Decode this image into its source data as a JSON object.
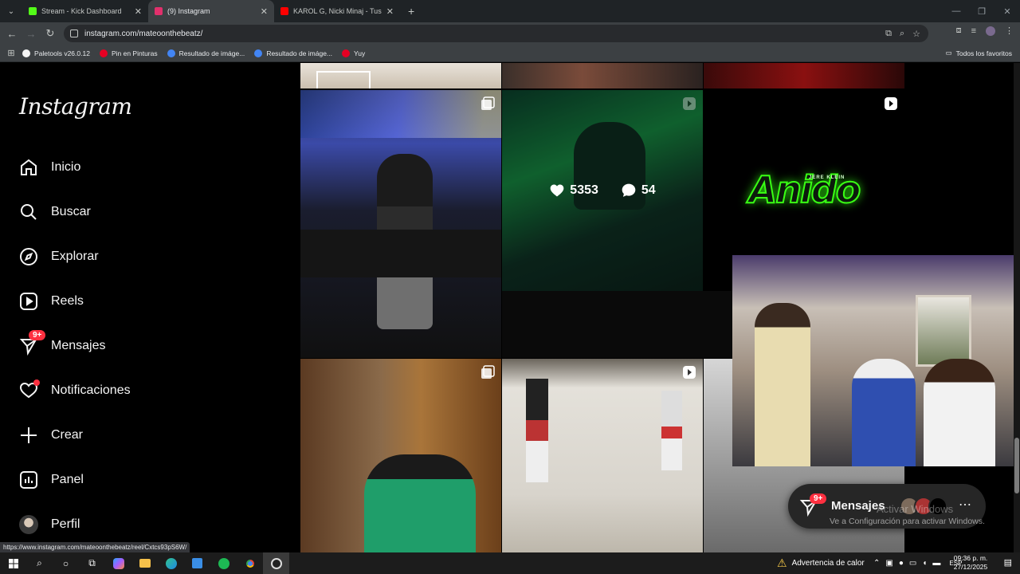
{
  "browser": {
    "tabs": [
      {
        "title": "Stream - Kick Dashboard",
        "favicon_color": "#53fc18",
        "active": false
      },
      {
        "title": "(9) Instagram",
        "favicon_color": "#e1306c",
        "active": true
      },
      {
        "title": "KAROL G, Nicki Minaj - Tusa (O",
        "favicon_color": "#ff0000",
        "active": false
      }
    ],
    "url": "instagram.com/mateoonthebeatz/",
    "bookmarks": [
      {
        "label": "Paletools v26.0.12",
        "color": "#f5f5f5"
      },
      {
        "label": "Pin en Pinturas",
        "color": "#e60023"
      },
      {
        "label": "Resultado de imáge...",
        "color": "#4285f4"
      },
      {
        "label": "Resultado de imáge...",
        "color": "#4285f4"
      },
      {
        "label": "Yuy",
        "color": "#e60023"
      }
    ],
    "all_bookmarks": "Todos los favoritos"
  },
  "instagram": {
    "logo": "Instagram",
    "nav": [
      {
        "label": "Inicio",
        "icon": "home-icon"
      },
      {
        "label": "Buscar",
        "icon": "search-icon"
      },
      {
        "label": "Explorar",
        "icon": "compass-icon"
      },
      {
        "label": "Reels",
        "icon": "reels-icon"
      },
      {
        "label": "Mensajes",
        "icon": "messenger-icon",
        "badge": "9+"
      },
      {
        "label": "Notificaciones",
        "icon": "heart-icon",
        "dot": true
      },
      {
        "label": "Crear",
        "icon": "plus-icon"
      },
      {
        "label": "Panel",
        "icon": "dashboard-icon"
      },
      {
        "label": "Perfil",
        "icon": "avatar"
      }
    ],
    "hover_post": {
      "likes": "5353",
      "comments": "54"
    },
    "neon_post": {
      "title": "Anido",
      "subtitle": "JERE KLEIN"
    },
    "messages_pill": {
      "label": "Mensajes",
      "badge": "9+"
    }
  },
  "status_url": "https://www.instagram.com/mateoonthebeatz/reel/Cxtcs93pS6W/",
  "windows": {
    "activate_title": "Activar Windows",
    "activate_text": "Ve a Configuración para activar Windows.",
    "weather": "Advertencia de calor",
    "language": "ESP",
    "time": "09:36 p. m.",
    "date": "27/12/2025"
  }
}
